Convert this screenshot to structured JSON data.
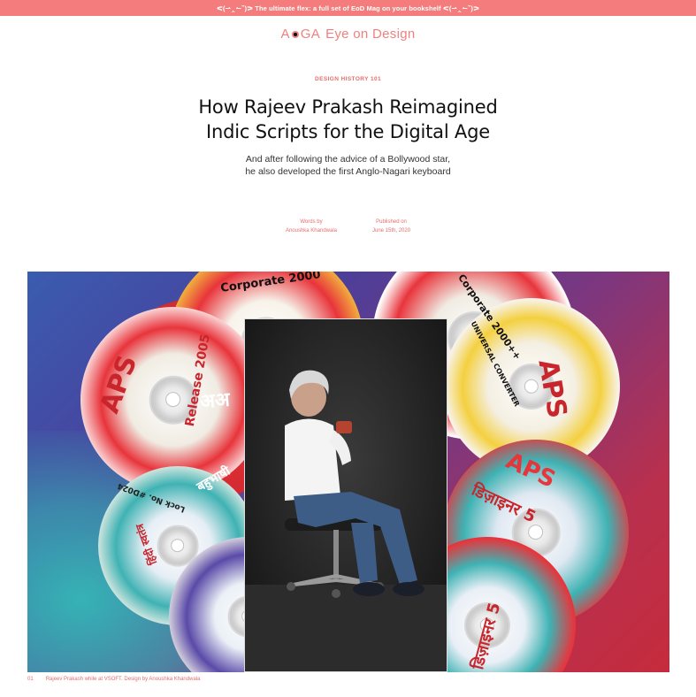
{
  "promo": {
    "text": "ᕙ(⇀‸↼‶)ᕗ The ultimate flex: a full set of EoD Mag on your bookshelf ᕙ(⇀‸↼‶)ᕗ"
  },
  "logo": {
    "brand_left": "A",
    "brand_right": "GA",
    "sub": "Eye on Design"
  },
  "article": {
    "eyebrow": "DESIGN HISTORY 101",
    "headline": "How Rajeev Prakash Reimagined Indic Scripts for the Digital Age",
    "dek": "And after following the advice of a Bollywood star, he also developed the first Anglo-Nagari keyboard",
    "credits": {
      "words_label": "Words by",
      "author": "Anoushka Khandwala",
      "published_label": "Published on",
      "date": "June 15th, 2020"
    }
  },
  "hero": {
    "disc_labels": {
      "corporate_2000": "Corporate 2000",
      "release_2005": "Release 2005",
      "aps": "APS",
      "aps_corporate_2000": "Corporate 2000++",
      "universal": "UNIVERSAL CONVERTER",
      "lock_no": "Lock No. #D024",
      "devanagari_1": "डिज़ाइनर 5",
      "devanagari_2": "हिंदी स्वतंत्र",
      "devanagari_3": "अअ",
      "devanagari_4": "बहुभाषी"
    },
    "colors": {
      "gradient_start": "#3a5cb0",
      "gradient_end": "#c62b3c",
      "disc_red": "#e8343b",
      "disc_teal": "#3fb2b3",
      "disc_purple": "#5a4aa8",
      "disc_yellow": "#f4d03f"
    }
  },
  "caption": {
    "index": "01",
    "text": "Rajeev Prakash while at VSOFT. Design by Anoushka Khandwala"
  },
  "colors": {
    "accent": "#f47c7c",
    "accent_text": "#e46e6e"
  }
}
